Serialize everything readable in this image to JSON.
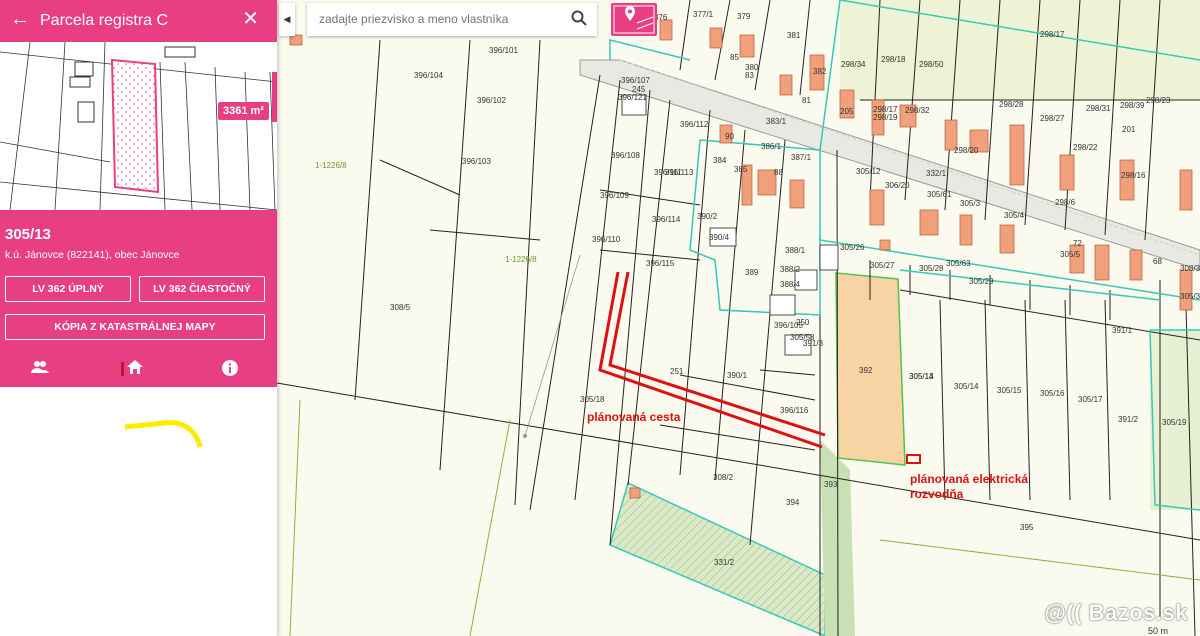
{
  "panel": {
    "title": "Parcela registra C",
    "back_icon": "arrow-left-icon",
    "close_icon": "close-icon",
    "area_badge": "3361 m²",
    "parcel_number": "305/13",
    "cadastral_area": "k.ú. Jánovce (822141), obec Jánovce",
    "buttons": {
      "lv_full": "LV 362 ÚPLNÝ",
      "lv_partial": "LV 362 ČIASTOČNÝ",
      "map_copy": "KÓPIA Z KATASTRÁLNEJ MAPY"
    },
    "tabs": [
      {
        "icon": "people-icon",
        "active": false
      },
      {
        "icon": "home-icon",
        "active": true
      },
      {
        "icon": "info-icon",
        "active": false
      }
    ],
    "accent_color": "#e83e84"
  },
  "search": {
    "placeholder": "zadajte priezvisko a meno vlastníka"
  },
  "map": {
    "parcels": [
      "376",
      "377/1",
      "379",
      "381",
      "298/17",
      "396/101",
      "396/104",
      "396/107",
      "245",
      "396/121",
      "85",
      "380",
      "83",
      "298/34",
      "298/18",
      "298/50",
      "382",
      "81",
      "298/28",
      "396/102",
      "396/112",
      "383/1",
      "205",
      "298/17",
      "298/19",
      "298/32",
      "298/27",
      "298/31",
      "298/39",
      "298/23",
      "201",
      "90",
      "384",
      "386/1",
      "387/1",
      "306/20",
      "298/20",
      "298/22",
      "396/103",
      "396/108",
      "1-1226/8",
      "305/12",
      "332/1",
      "298/16",
      "396/113",
      "385",
      "396/111",
      "396/109",
      "88",
      "305/61",
      "305/4",
      "298/6",
      "396/114",
      "390/2",
      "390/4",
      "305/3",
      "305/14",
      "72",
      "68",
      "1-1226/8",
      "396/110",
      "388/1",
      "305/26",
      "396/115",
      "389",
      "388/2",
      "305/27",
      "305/28",
      "305/63",
      "305/5",
      "308/3",
      "388/4",
      "250",
      "305/29",
      "305/30",
      "308/5",
      "396/105",
      "391/1",
      "305/58",
      "391/3",
      "251",
      "390/1",
      "392",
      "305/13",
      "305/14",
      "305/15",
      "305/16",
      "305/17",
      "305/18",
      "396/116",
      "391/2",
      "305/19",
      "308/2",
      "394",
      "393",
      "331/2",
      "395",
      "305/40"
    ],
    "annotations": {
      "road": "plánovaná cesta",
      "substation_line1": "plánovaná elektrická",
      "substation_line2": "rozvodňa"
    },
    "scale_label": "50 m"
  },
  "watermark": "@(( Bazos.sk"
}
